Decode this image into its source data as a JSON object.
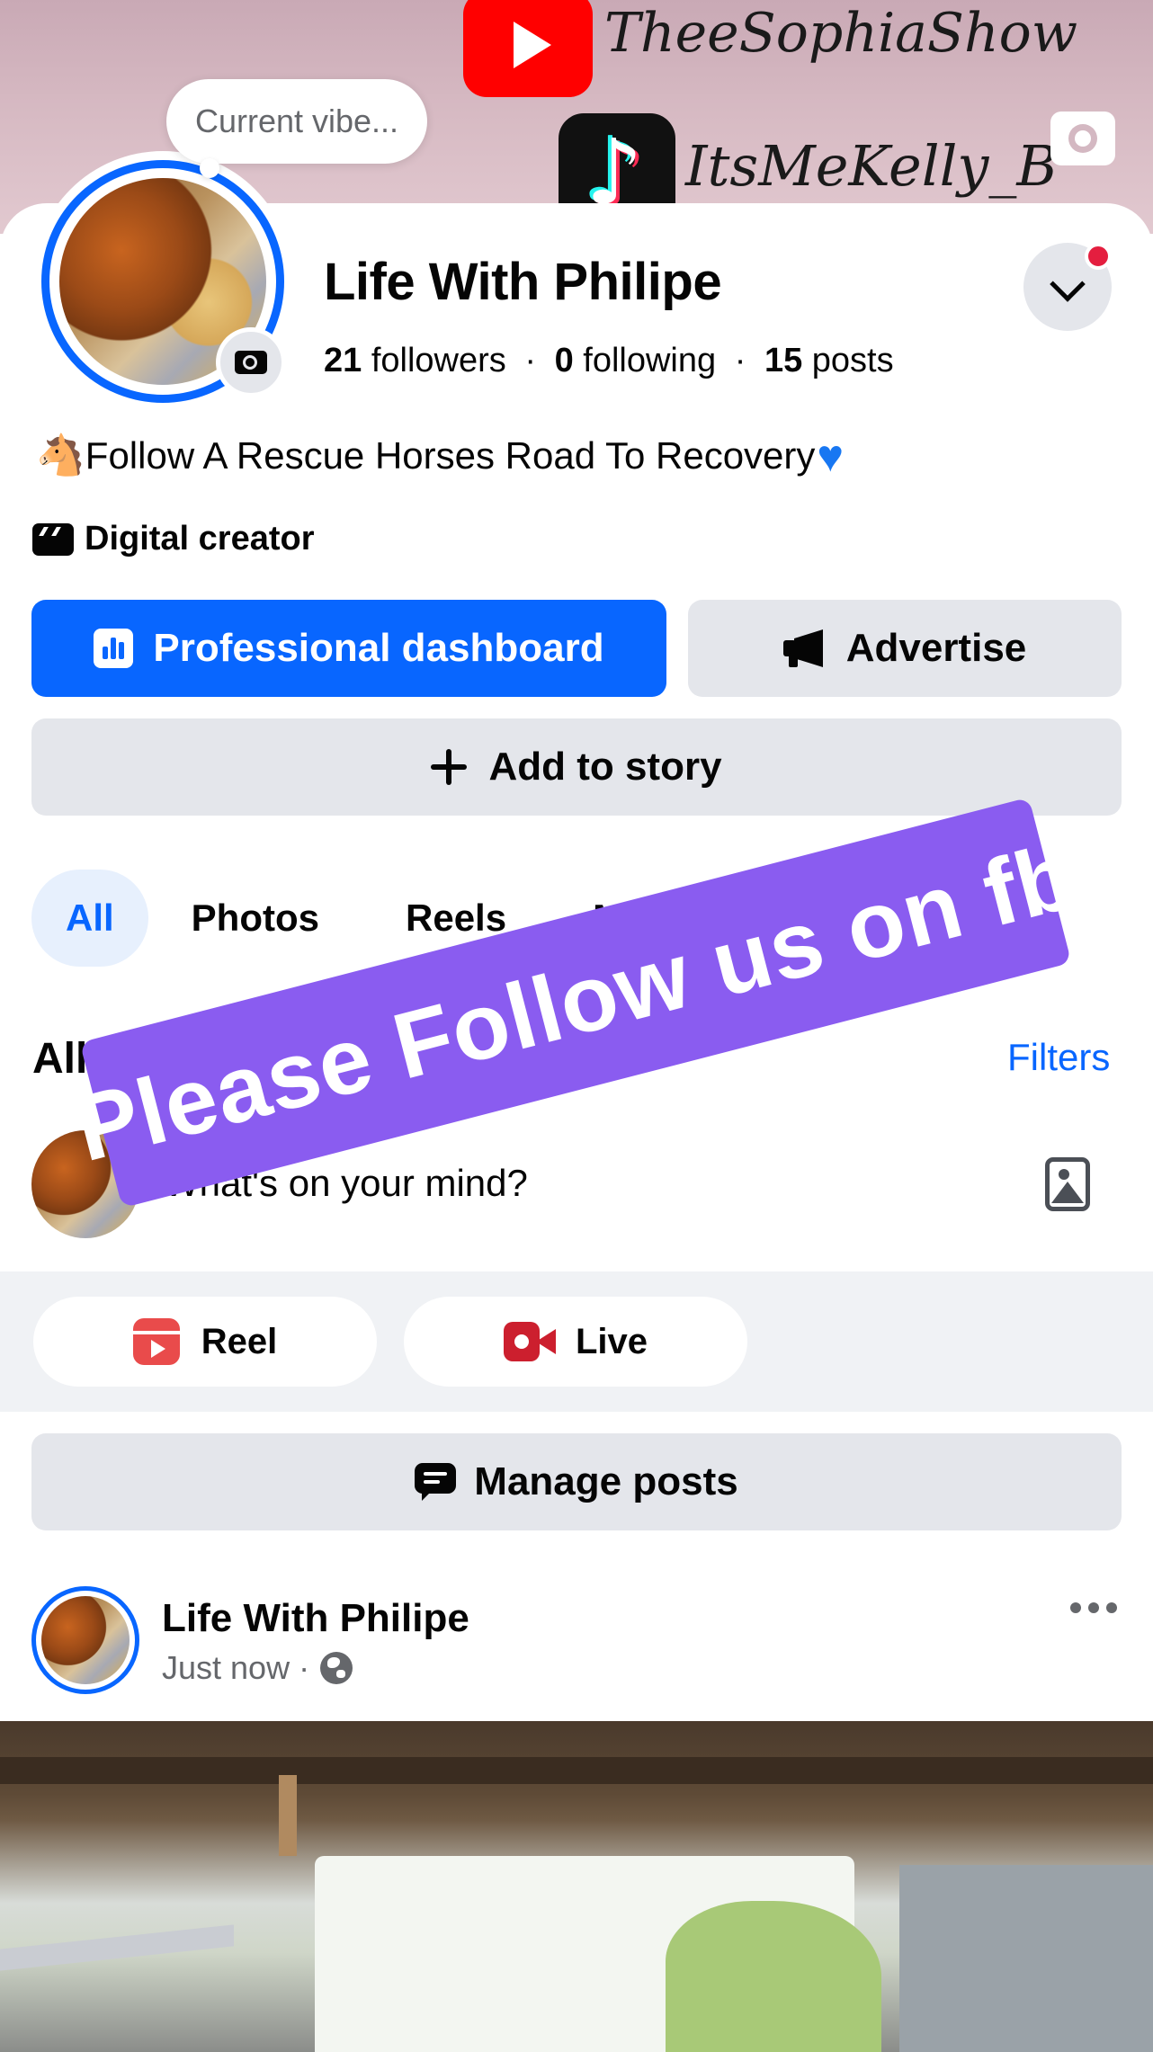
{
  "cover": {
    "youtube_handle": "TheeSophiaShow",
    "tiktok_handle": "ItsMeKelly_B",
    "tiktok_glyph": "♪"
  },
  "profile": {
    "vibe_placeholder": "Current vibe...",
    "name": "Life With Philipe",
    "followers_count": "21",
    "followers_label": "followers",
    "following_count": "0",
    "following_label": "following",
    "posts_count": "15",
    "posts_label": "posts",
    "separator": "·",
    "bio_emoji": "🐴",
    "bio_text": "Follow A Rescue Horses Road To Recovery",
    "bio_heart": "♥",
    "category": "Digital creator"
  },
  "actions": {
    "dashboard_label": "Professional dashboard",
    "advertise_label": "Advertise",
    "add_story_label": "Add to story"
  },
  "tabs": [
    {
      "label": "All",
      "active": true
    },
    {
      "label": "Photos",
      "active": false
    },
    {
      "label": "Reels",
      "active": false
    },
    {
      "label": "Mentions",
      "active": false
    }
  ],
  "posts_section": {
    "title": "All posts",
    "filters_label": "Filters",
    "composer_placeholder": "What's on your mind?",
    "reel_label": "Reel",
    "live_label": "Live",
    "manage_label": "Manage posts"
  },
  "post": {
    "author": "Life With Philipe",
    "time": "Just now",
    "meta_sep": "·"
  },
  "sticker": {
    "text": "Please Follow us on fb"
  },
  "colors": {
    "accent": "#0866ff",
    "sticker_bg": "#8a5cf0",
    "notification": "#e41e3f",
    "cover": "#d6b9c2"
  }
}
